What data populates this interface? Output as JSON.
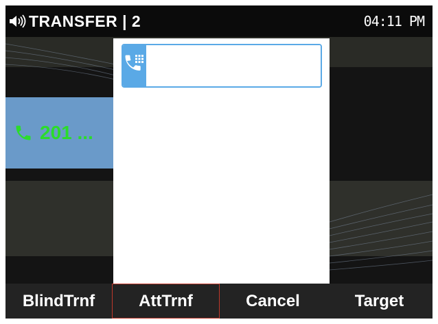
{
  "status_bar": {
    "title": "TRANSFER | 2",
    "time": "04:11 PM",
    "icon": "speaker-volume-icon"
  },
  "call_line": {
    "label": "201 ...",
    "icon": "phone-icon",
    "label_color": "#2bdc2b",
    "highlight_color": "#6a9ac9"
  },
  "transfer_dialog": {
    "input_icon": "dialpad-phone-icon",
    "number_value": "",
    "accent_color": "#5aa9e6"
  },
  "softkeys": [
    {
      "label": "BlindTrnf",
      "selected": false
    },
    {
      "label": "AttTrnf",
      "selected": true
    },
    {
      "label": "Cancel",
      "selected": false
    },
    {
      "label": "Target",
      "selected": false
    }
  ]
}
